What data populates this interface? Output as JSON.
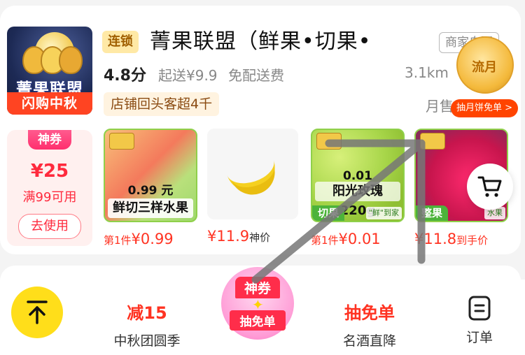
{
  "store": {
    "logo_text": "菁果联盟",
    "logo_banner": "闪购中秋",
    "chain_tag": "连锁",
    "name": "菁果联盟（鲜果•切果•",
    "delivery_type": "商家自配",
    "rating": "4.8分",
    "min_order": "起送¥9.9",
    "delivery_fee": "免配送费",
    "distance": "3.1km",
    "repeat_tag": "店铺回头客超4千",
    "monthly_sales": "月售",
    "mooncake_text": "流月",
    "mooncake_pill": "抽月饼免单 >"
  },
  "coupon": {
    "tag": "神券",
    "amount": "¥25",
    "condition": "满99可用",
    "button": "去使用"
  },
  "products": [
    {
      "overlay_num": "0.99 元",
      "caption": "鲜切三样水果",
      "price_prefix": "第1件",
      "price": "¥0.99",
      "price_suffix": ""
    },
    {
      "overlay_num": "",
      "caption": "",
      "price_prefix": "",
      "price": "¥11.9",
      "price_suffix": "神价"
    },
    {
      "overlay_num": "0.01",
      "caption": "阳光玫瑰220g",
      "category": "切果",
      "sub": "\"鲜\"到家",
      "price_prefix": "第1件",
      "price": "¥0.01",
      "price_suffix": ""
    },
    {
      "overlay_num": "",
      "caption": "",
      "category": "整果",
      "sub": "水果",
      "price_prefix": "",
      "price": "¥11.8",
      "price_suffix": "到手价"
    }
  ],
  "tabs": {
    "t1_main": "减15",
    "t1_label": "中秋团圆季",
    "center_top": "神券",
    "center_bottom": "抽免单",
    "t3_main": "抽免单",
    "t3_label": "名酒直降",
    "t4_label": "订单"
  },
  "icons": {
    "scroll_top": "arrow-up-icon",
    "cart": "cart-icon",
    "orders": "order-list-icon"
  },
  "colors": {
    "accent_red": "#ff3322",
    "yellow": "#ffde1a",
    "brand_orange": "#ff4422"
  }
}
